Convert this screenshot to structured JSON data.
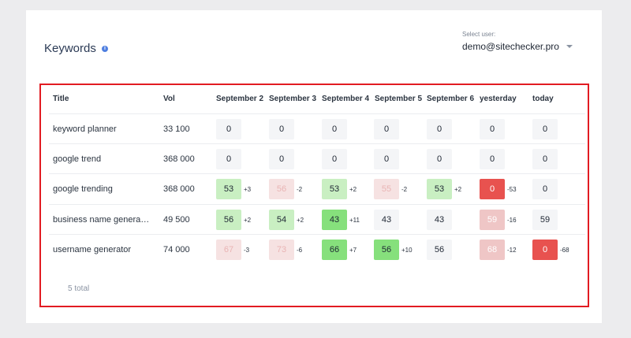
{
  "header": {
    "title": "Keywords",
    "info_icon": "info-icon",
    "user_label": "Select user:",
    "user_value": "demo@sitechecker.pro"
  },
  "columns": [
    "Title",
    "Vol",
    "September 2",
    "September 3",
    "September 4",
    "September 5",
    "September 6",
    "yesterday",
    "today"
  ],
  "rows": [
    {
      "title": "keyword planner",
      "vol": "33 100",
      "cells": [
        {
          "value": "0",
          "delta": ""
        },
        {
          "value": "0",
          "delta": ""
        },
        {
          "value": "0",
          "delta": ""
        },
        {
          "value": "0",
          "delta": ""
        },
        {
          "value": "0",
          "delta": ""
        },
        {
          "value": "0",
          "delta": ""
        },
        {
          "value": "0",
          "delta": ""
        }
      ]
    },
    {
      "title": "google trend",
      "vol": "368 000",
      "cells": [
        {
          "value": "0",
          "delta": ""
        },
        {
          "value": "0",
          "delta": ""
        },
        {
          "value": "0",
          "delta": ""
        },
        {
          "value": "0",
          "delta": ""
        },
        {
          "value": "0",
          "delta": ""
        },
        {
          "value": "0",
          "delta": ""
        },
        {
          "value": "0",
          "delta": ""
        }
      ]
    },
    {
      "title": "google trending",
      "vol": "368 000",
      "cells": [
        {
          "value": "53",
          "delta": "+3",
          "color": "#c9efc2"
        },
        {
          "value": "56",
          "delta": "-2",
          "color": "#f6e2e2"
        },
        {
          "value": "53",
          "delta": "+2",
          "color": "#c9efc2"
        },
        {
          "value": "55",
          "delta": "-2",
          "color": "#f6e2e2"
        },
        {
          "value": "53",
          "delta": "+2",
          "color": "#c9efc2"
        },
        {
          "value": "0",
          "delta": "-53",
          "color": "#e8524f"
        },
        {
          "value": "0",
          "delta": ""
        }
      ]
    },
    {
      "title": "business name generator",
      "vol": "49 500",
      "cells": [
        {
          "value": "56",
          "delta": "+2",
          "color": "#c9efc2"
        },
        {
          "value": "54",
          "delta": "+2",
          "color": "#c9efc2"
        },
        {
          "value": "43",
          "delta": "+11",
          "color": "#86e07c"
        },
        {
          "value": "43",
          "delta": ""
        },
        {
          "value": "43",
          "delta": ""
        },
        {
          "value": "59",
          "delta": "-16",
          "color": "#efc6c6"
        },
        {
          "value": "59",
          "delta": ""
        }
      ]
    },
    {
      "title": "username generator",
      "vol": "74 000",
      "cells": [
        {
          "value": "67",
          "delta": "-3",
          "color": "#f6e2e2"
        },
        {
          "value": "73",
          "delta": "-6",
          "color": "#f6e2e2"
        },
        {
          "value": "66",
          "delta": "+7",
          "color": "#86e07c"
        },
        {
          "value": "56",
          "delta": "+10",
          "color": "#86e07c"
        },
        {
          "value": "56",
          "delta": ""
        },
        {
          "value": "68",
          "delta": "-12",
          "color": "#efc6c6"
        },
        {
          "value": "0",
          "delta": "-68",
          "color": "#e8524f"
        }
      ]
    }
  ],
  "footer": {
    "total": "5 total"
  },
  "colors": {
    "highlight_frame": "#e21b22",
    "neutral_cell": "#f4f5f7",
    "strong_red_text": "#ffffff",
    "light_red_text": "#e9b4b4"
  }
}
